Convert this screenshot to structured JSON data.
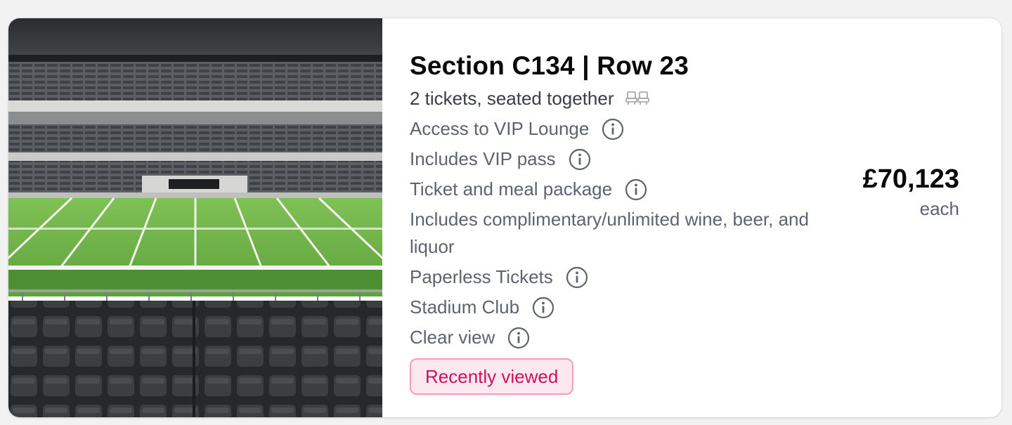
{
  "listing": {
    "title": "Section C134 | Row 23",
    "subtitle": "2 tickets, seated together",
    "seat_icon": "seats-together-icon",
    "features": [
      {
        "label": "Access to VIP Lounge",
        "has_info": true
      },
      {
        "label": "Includes VIP pass",
        "has_info": true
      },
      {
        "label": "Ticket and meal package",
        "has_info": true
      },
      {
        "label": "Includes complimentary/unlimited wine, beer, and liquor",
        "has_info": false
      },
      {
        "label": "Paperless Tickets",
        "has_info": true
      },
      {
        "label": "Stadium Club",
        "has_info": true
      },
      {
        "label": "Clear view",
        "has_info": true
      }
    ],
    "badge": "Recently viewed",
    "price": "£70,123",
    "price_unit": "each",
    "image": "stadium-view-image"
  },
  "colors": {
    "badge_text": "#d0105e",
    "badge_bg": "#fde8ef",
    "badge_border": "#f59bbb",
    "muted_text": "#5e6370",
    "title_text": "#0a0a0a"
  }
}
